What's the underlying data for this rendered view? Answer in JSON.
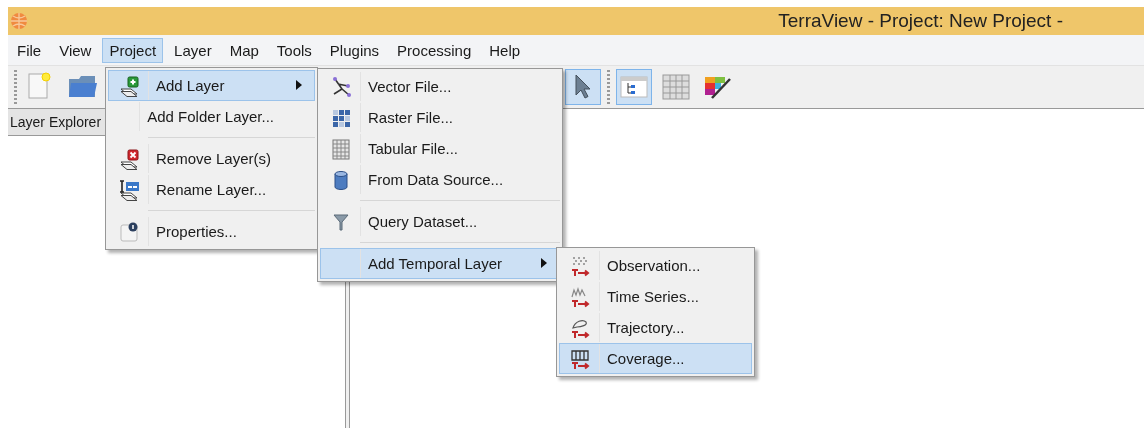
{
  "window": {
    "title": "TerraView - Project: New Project -"
  },
  "menubar": [
    {
      "label": "File",
      "selected": false
    },
    {
      "label": "View",
      "selected": false
    },
    {
      "label": "Project",
      "selected": true
    },
    {
      "label": "Layer",
      "selected": false
    },
    {
      "label": "Map",
      "selected": false
    },
    {
      "label": "Tools",
      "selected": false
    },
    {
      "label": "Plugins",
      "selected": false
    },
    {
      "label": "Processing",
      "selected": false
    },
    {
      "label": "Help",
      "selected": false
    }
  ],
  "toolbar": {
    "groups": [
      {
        "buttons": [
          {
            "selected": false
          },
          {
            "selected": false
          }
        ]
      },
      {
        "buttons": [
          {
            "selected": true
          }
        ]
      },
      {
        "buttons": [
          {
            "selected": true
          },
          {
            "selected": false
          },
          {
            "selected": false
          }
        ]
      }
    ]
  },
  "dock": {
    "title": "Layer Explorer"
  },
  "menus": [
    {
      "items": [
        {
          "kind": "item",
          "label": "Add Layer",
          "selected": true,
          "submenu": true
        },
        {
          "kind": "item",
          "label": "Add Folder Layer...",
          "selected": false,
          "submenu": false
        },
        {
          "kind": "separator"
        },
        {
          "kind": "item",
          "label": "Remove Layer(s)",
          "selected": false,
          "submenu": false
        },
        {
          "kind": "item",
          "label": "Rename Layer...",
          "selected": false,
          "submenu": false
        },
        {
          "kind": "separator"
        },
        {
          "kind": "item",
          "label": "Properties...",
          "selected": false,
          "submenu": false
        }
      ]
    },
    {
      "items": [
        {
          "kind": "item",
          "label": "Vector File...",
          "selected": false,
          "submenu": false
        },
        {
          "kind": "item",
          "label": "Raster File...",
          "selected": false,
          "submenu": false
        },
        {
          "kind": "item",
          "label": "Tabular File...",
          "selected": false,
          "submenu": false
        },
        {
          "kind": "item",
          "label": "From Data Source...",
          "selected": false,
          "submenu": false
        },
        {
          "kind": "separator"
        },
        {
          "kind": "item",
          "label": "Query Dataset...",
          "selected": false,
          "submenu": false
        },
        {
          "kind": "separator"
        },
        {
          "kind": "item",
          "label": "Add Temporal Layer",
          "selected": true,
          "submenu": true
        }
      ]
    },
    {
      "items": [
        {
          "kind": "item",
          "label": "Observation...",
          "selected": false,
          "submenu": false
        },
        {
          "kind": "item",
          "label": "Time Series...",
          "selected": false,
          "submenu": false
        },
        {
          "kind": "item",
          "label": "Trajectory...",
          "selected": false,
          "submenu": false
        },
        {
          "kind": "item",
          "label": "Coverage...",
          "selected": true,
          "submenu": false
        }
      ]
    }
  ]
}
